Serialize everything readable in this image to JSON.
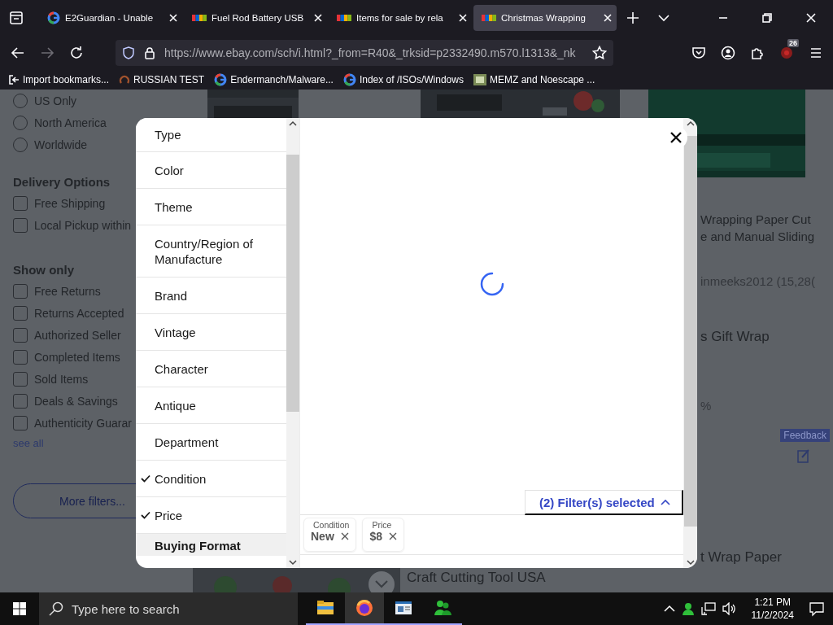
{
  "browser": {
    "tabs": [
      {
        "title": "E2Guardian - Unable",
        "kind": "google",
        "selected": false
      },
      {
        "title": "Fuel Rod Battery USB",
        "kind": "ebay",
        "selected": false
      },
      {
        "title": "Items for sale by rela",
        "kind": "ebay",
        "selected": false
      },
      {
        "title": "Christmas Wrapping",
        "kind": "ebay",
        "selected": true
      }
    ],
    "url": "https://www.ebay.com/sch/i.html?_from=R40&_trksid=p2332490.m570.l1313&_nk",
    "extension_badge": "26",
    "bookmarks": [
      {
        "label": "Import bookmarks...",
        "kind": "import"
      },
      {
        "label": "RUSSIAN TEST",
        "kind": "swirl"
      },
      {
        "label": "Endermanch/Malware...",
        "kind": "google"
      },
      {
        "label": "Index of /ISOs/Windows",
        "kind": "google"
      },
      {
        "label": "MEMZ and Noescape ...",
        "kind": "tile"
      }
    ]
  },
  "page": {
    "locations": [
      {
        "label": "US Only",
        "selected": false
      },
      {
        "label": "North America",
        "selected": false
      },
      {
        "label": "Worldwide",
        "selected": false
      }
    ],
    "sections": [
      {
        "heading": "Delivery Options",
        "options": [
          {
            "label": "Free Shipping",
            "checked": false
          },
          {
            "label": "Local Pickup within",
            "checked": false
          }
        ]
      },
      {
        "heading": "Show only",
        "options": [
          {
            "label": "Free Returns",
            "checked": false
          },
          {
            "label": "Returns Accepted",
            "checked": false
          },
          {
            "label": "Authorized Seller",
            "checked": false
          },
          {
            "label": "Completed Items",
            "checked": false
          },
          {
            "label": "Sold Items",
            "checked": false
          },
          {
            "label": "Deals & Savings",
            "checked": false
          },
          {
            "label": "Authenticity Guarar",
            "checked": false
          }
        ]
      }
    ],
    "see_all": "see all",
    "more_filters": "More filters...",
    "center_title": "Craft Cutting Tool USA",
    "right_lines": [
      {
        "text": "Wrapping Paper Cut",
        "kind": "title"
      },
      {
        "text": "e and Manual Sliding",
        "kind": "title"
      },
      {
        "text": "inmeeks2012 (15,28(",
        "kind": "meta"
      },
      {
        "text": "s Gift Wrap",
        "kind": "big"
      },
      {
        "text": "%",
        "kind": "meta"
      },
      {
        "text": "Feedback",
        "kind": "feedback"
      },
      {
        "text": "t Wrap Paper",
        "kind": "big"
      }
    ]
  },
  "modal": {
    "categories": [
      {
        "label": "Type",
        "checked": false
      },
      {
        "label": "Color",
        "checked": false
      },
      {
        "label": "Theme",
        "checked": false
      },
      {
        "label": "Country/Region of Manufacture",
        "checked": false
      },
      {
        "label": "Brand",
        "checked": false
      },
      {
        "label": "Vintage",
        "checked": false
      },
      {
        "label": "Character",
        "checked": false
      },
      {
        "label": "Antique",
        "checked": false
      },
      {
        "label": "Department",
        "checked": false
      },
      {
        "label": "Condition",
        "checked": true
      },
      {
        "label": "Price",
        "checked": true
      },
      {
        "label": "Buying Format",
        "checked": false
      }
    ],
    "filter_summary": "(2) Filter(s) selected",
    "chips": [
      {
        "label": "Condition",
        "value": "New"
      },
      {
        "label": "Price",
        "value": "$8"
      }
    ]
  },
  "taskbar": {
    "search_placeholder": "Type here to search",
    "time": "1:21 PM",
    "date": "11/2/2024"
  }
}
